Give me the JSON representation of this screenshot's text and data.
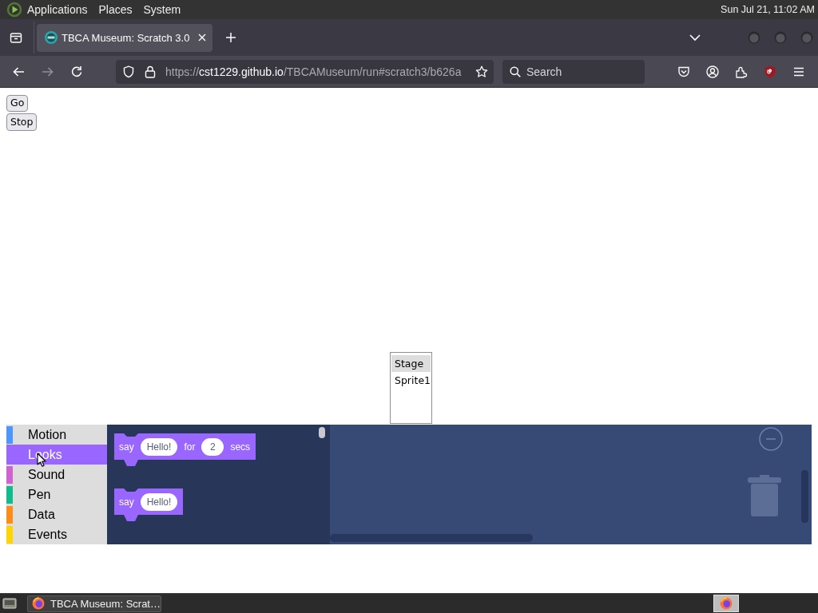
{
  "top_panel": {
    "menus": [
      "Applications",
      "Places",
      "System"
    ],
    "clock": "Sun Jul 21, 11:02 AM"
  },
  "browser": {
    "tabs": [
      {
        "title": "TBCA Museum: Scratch 3.0",
        "selected": true
      }
    ],
    "address": {
      "scheme": "https://",
      "host": "cst1229.github.io",
      "path": "/TBCAMuseum/run#scratch3/b626a"
    },
    "search": {
      "placeholder": "Search"
    }
  },
  "page": {
    "buttons": [
      "Go",
      "Stop"
    ],
    "sprite_list": [
      {
        "name": "Stage",
        "selected": true
      },
      {
        "name": "Sprite1",
        "selected": false
      }
    ],
    "editor": {
      "categories": [
        {
          "name": "Motion",
          "color": "#4c97ff",
          "selected": false
        },
        {
          "name": "Looks",
          "color": "#9966ff",
          "selected": true
        },
        {
          "name": "Sound",
          "color": "#cf63cf",
          "selected": false
        },
        {
          "name": "Pen",
          "color": "#0fbd8c",
          "selected": false
        },
        {
          "name": "Data",
          "color": "#ff8c1a",
          "selected": false
        },
        {
          "name": "Events",
          "color": "#ffd500",
          "selected": false
        }
      ],
      "blocks": [
        {
          "parts": [
            {
              "kind": "label",
              "text": "say"
            },
            {
              "kind": "text_input",
              "text": "Hello!"
            },
            {
              "kind": "label",
              "text": "for"
            },
            {
              "kind": "number_input",
              "text": "2"
            },
            {
              "kind": "label",
              "text": "secs"
            }
          ]
        },
        {
          "parts": [
            {
              "kind": "label",
              "text": "say"
            },
            {
              "kind": "text_input",
              "text": "Hello!"
            }
          ]
        }
      ]
    }
  },
  "taskbar": {
    "windows": [
      {
        "title": "TBCA Museum: Scrat…"
      }
    ]
  }
}
